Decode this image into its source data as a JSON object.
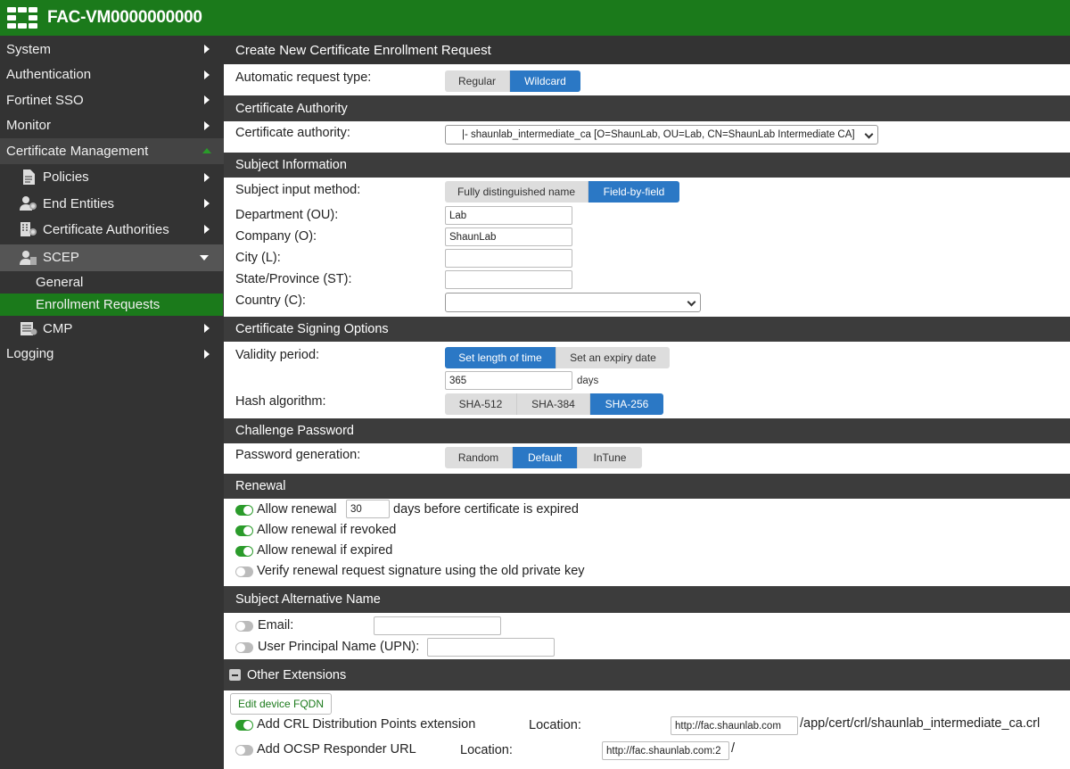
{
  "app": {
    "title": "FAC-VM0000000000"
  },
  "sidebar": {
    "items": [
      "System",
      "Authentication",
      "Fortinet SSO",
      "Monitor",
      "Certificate Management"
    ],
    "cm_sub": [
      "Policies",
      "End Entities",
      "Certificate Authorities",
      "SCEP"
    ],
    "scep_sub": [
      "General",
      "Enrollment Requests"
    ],
    "cmp": "CMP",
    "logging": "Logging"
  },
  "page": {
    "title": "Create New Certificate Enrollment Request"
  },
  "request_type": {
    "label": "Automatic request type:",
    "options": [
      "Regular",
      "Wildcard"
    ],
    "selected": "Wildcard"
  },
  "ca": {
    "section": "Certificate Authority",
    "label": "Certificate authority:",
    "value": "|- shaunlab_intermediate_ca [O=ShaunLab, OU=Lab, CN=ShaunLab Intermediate CA]"
  },
  "subject": {
    "section": "Subject Information",
    "method_label": "Subject input method:",
    "methods": [
      "Fully distinguished name",
      "Field-by-field"
    ],
    "method_selected": "Field-by-field",
    "ou_label": "Department (OU):",
    "ou": "Lab",
    "o_label": "Company (O):",
    "o": "ShaunLab",
    "l_label": "City (L):",
    "l": "",
    "st_label": "State/Province (ST):",
    "st": "",
    "c_label": "Country (C):",
    "c": ""
  },
  "signing": {
    "section": "Certificate Signing Options",
    "validity_label": "Validity period:",
    "validity_options": [
      "Set length of time",
      "Set an expiry date"
    ],
    "validity_selected": "Set length of time",
    "days": "365",
    "days_unit": "days",
    "hash_label": "Hash algorithm:",
    "hash_options": [
      "SHA-512",
      "SHA-384",
      "SHA-256"
    ],
    "hash_selected": "SHA-256"
  },
  "challenge": {
    "section": "Challenge Password",
    "label": "Password generation:",
    "options": [
      "Random",
      "Default",
      "InTune"
    ],
    "selected": "Default"
  },
  "renewal": {
    "section": "Renewal",
    "allow_label": "Allow renewal",
    "allow_days": "30",
    "allow_suffix": "days before certificate is expired",
    "allow_on": true,
    "revoked_label": "Allow renewal if revoked",
    "revoked_on": true,
    "expired_label": "Allow renewal if expired",
    "expired_on": true,
    "verify_label": "Verify renewal request signature using the old private key",
    "verify_on": false
  },
  "san": {
    "section": "Subject Alternative Name",
    "email_label": "Email:",
    "email_on": false,
    "upn_label": "User Principal Name (UPN):",
    "upn_on": false
  },
  "other": {
    "section": "Other Extensions",
    "fqdn_button": "Edit device FQDN",
    "crl_label": "Add CRL Distribution Points extension",
    "crl_on": true,
    "crl_location_label": "Location:",
    "crl_location": "http://fac.shaunlab.com",
    "crl_suffix": "/app/cert/crl/shaunlab_intermediate_ca.crl",
    "ocsp_label": "Add OCSP Responder URL",
    "ocsp_on": false,
    "ocsp_location_label": "Location:",
    "ocsp_location": "http://fac.shaunlab.com:2",
    "ocsp_suffix": "/"
  },
  "colors": {
    "brand": "#1b7a1b",
    "accent": "#2b78c5",
    "toggle_on": "#2b9b2b"
  }
}
